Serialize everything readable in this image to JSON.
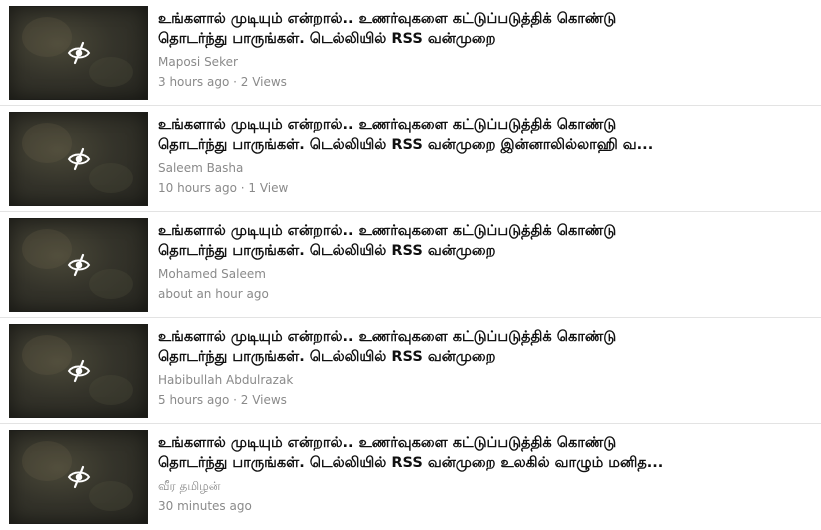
{
  "videos": [
    {
      "title_line1": "உங்களால் முடியும் என்றால்.. உணர்வுகளை கட்டுப்படுத்திக் கொண்டு",
      "title_line2": "தொடர்ந்து பாருங்கள். டெல்லியில் RSS வன்முறை",
      "author": "Maposi Seker",
      "meta": "3 hours ago · 2 Views",
      "thumbnail_icon": "eye-slash-icon"
    },
    {
      "title_line1": "உங்களால் முடியும் என்றால்.. உணர்வுகளை கட்டுப்படுத்திக் கொண்டு",
      "title_line2": "தொடர்ந்து பாருங்கள். டெல்லியில் RSS வன்முறை இன்னாலில்லாஹி வ...",
      "author": "Saleem Basha",
      "meta": "10 hours ago · 1 View",
      "thumbnail_icon": "eye-slash-icon"
    },
    {
      "title_line1": "உங்களால் முடியும் என்றால்.. உணர்வுகளை கட்டுப்படுத்திக் கொண்டு",
      "title_line2": "தொடர்ந்து பாருங்கள். டெல்லியில் RSS வன்முறை",
      "author": "Mohamed Saleem",
      "meta": "about an hour ago",
      "thumbnail_icon": "eye-slash-icon"
    },
    {
      "title_line1": "உங்களால் முடியும் என்றால்.. உணர்வுகளை கட்டுப்படுத்திக் கொண்டு",
      "title_line2": "தொடர்ந்து பாருங்கள். டெல்லியில் RSS வன்முறை",
      "author": "Habibullah Abdulrazak",
      "meta": "5 hours ago · 2 Views",
      "thumbnail_icon": "eye-slash-icon"
    },
    {
      "title_line1": "உங்களால் முடியும் என்றால்.. உணர்வுகளை கட்டுப்படுத்திக் கொண்டு",
      "title_line2": "தொடர்ந்து பாருங்கள். டெல்லியில் RSS வன்முறை உலகில் வாழும் மனித...",
      "author": "வீர தமிழன்",
      "meta": "30 minutes ago",
      "thumbnail_icon": "eye-slash-icon"
    }
  ]
}
